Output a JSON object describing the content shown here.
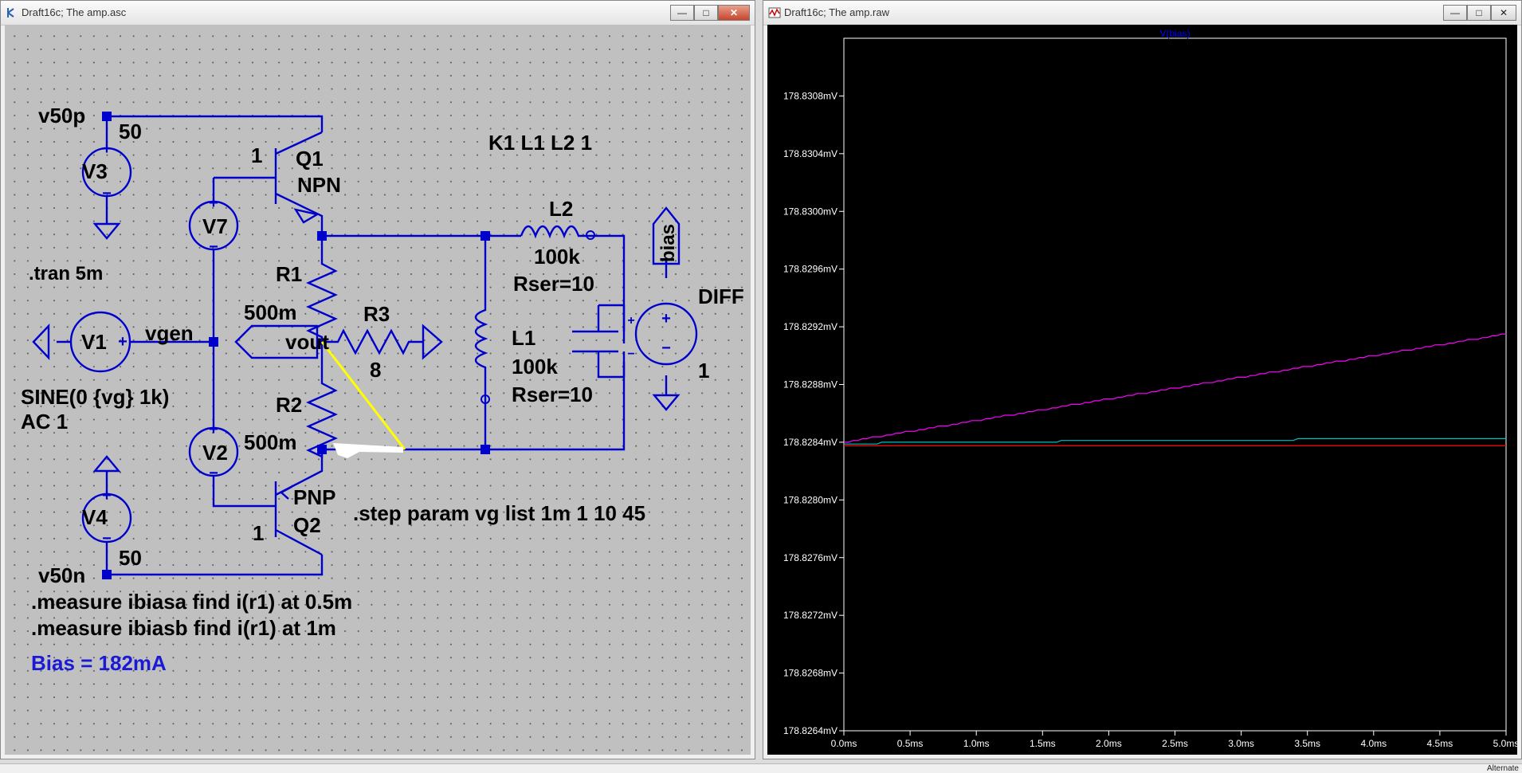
{
  "schematic_window": {
    "title": "Draft16c; The amp.asc",
    "buttons": {
      "minimize": "—",
      "maximize": "□",
      "close": "✕"
    }
  },
  "waveform_window": {
    "title": "Draft16c; The amp.raw",
    "buttons": {
      "minimize": "—",
      "maximize": "□",
      "close": "✕"
    }
  },
  "schematic": {
    "net_labels": {
      "v50p": "v50p",
      "v50n": "v50n",
      "vgen": "vgen",
      "vout": "vout",
      "bias": "bias"
    },
    "components": {
      "V3": {
        "name": "V3",
        "value": "50"
      },
      "V4": {
        "name": "V4",
        "value": "50"
      },
      "V7": {
        "name": "V7"
      },
      "V2": {
        "name": "V2"
      },
      "V1": {
        "name": "V1"
      },
      "Q1": {
        "name": "Q1",
        "model": "NPN",
        "area": "1"
      },
      "Q2": {
        "name": "Q2",
        "model": "PNP",
        "area": "1"
      },
      "R1": {
        "name": "R1",
        "value": "500m"
      },
      "R2": {
        "name": "R2",
        "value": "500m"
      },
      "R3": {
        "name": "R3",
        "value": "8"
      },
      "L1": {
        "name": "L1",
        "value": "100k",
        "rser": "Rser=10"
      },
      "L2": {
        "name": "L2",
        "value": "100k",
        "rser": "Rser=10"
      },
      "DIFF": {
        "name": "DIFF",
        "gain": "1"
      }
    },
    "directives": {
      "tran": ".tran 5m",
      "coupling": "K1 L1 L2 1",
      "source_line1": "SINE(0 {vg} 1k)",
      "source_line2": "AC 1",
      "step": ".step param vg list 1m 1 10 45",
      "measure1": ".measure ibiasa find i(r1) at 0.5m",
      "measure2": ".measure ibiasb find i(r1) at 1m",
      "bias_comment": "Bias = 182mA"
    },
    "colors": {
      "wire": "#0000cc",
      "highlight": "#ffff00",
      "text": "#000000",
      "comment": "#1a1ad6"
    }
  },
  "status": {
    "right_text": "Alternate"
  },
  "chart_data": {
    "type": "line",
    "title": "V(bias)",
    "xlabel": "",
    "ylabel": "",
    "xlim": [
      0,
      5.0
    ],
    "ylim": [
      178.8264,
      178.8312
    ],
    "x_ticks": [
      "0.0ms",
      "0.5ms",
      "1.0ms",
      "1.5ms",
      "2.0ms",
      "2.5ms",
      "3.0ms",
      "3.5ms",
      "4.0ms",
      "4.5ms",
      "5.0ms"
    ],
    "y_ticks": [
      "178.8308mV",
      "178.8304mV",
      "178.8300mV",
      "178.8296mV",
      "178.8292mV",
      "178.8288mV",
      "178.8284mV",
      "178.8280mV",
      "178.8276mV",
      "178.8272mV",
      "178.8268mV",
      "178.8264mV"
    ],
    "y_tick_values": [
      178.8308,
      178.8304,
      178.83,
      178.8296,
      178.8292,
      178.8288,
      178.8284,
      178.828,
      178.8276,
      178.8272,
      178.8268,
      178.8264
    ],
    "grid": false,
    "colors": {
      "frame": "#ffffff",
      "tick_text": "#ffffff",
      "title": "#0000ff"
    },
    "series": [
      {
        "color": "#ff00ff",
        "x": [
          0,
          1,
          2,
          3,
          4,
          5
        ],
        "values": [
          178.8284,
          178.82855,
          178.8287,
          178.82885,
          178.829,
          178.82915
        ]
      },
      {
        "color": "#00bfbf",
        "x": [
          0,
          0.7,
          2.2,
          3.6,
          5
        ],
        "values": [
          178.82839,
          178.8284,
          178.82841,
          178.82842,
          178.82843
        ]
      },
      {
        "color": "#ff0000",
        "x": [
          0,
          5
        ],
        "values": [
          178.82838,
          178.82838
        ]
      }
    ]
  }
}
